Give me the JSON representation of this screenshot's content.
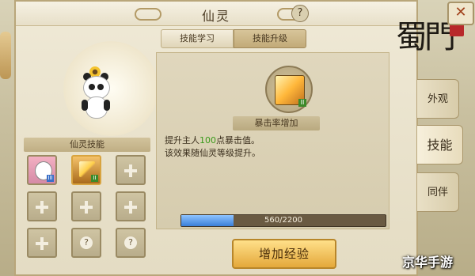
{
  "window": {
    "title": "仙灵"
  },
  "tabs": [
    {
      "label": "技能学习"
    },
    {
      "label": "技能升级"
    }
  ],
  "skills_panel": {
    "title": "仙灵技能"
  },
  "slots": [
    {
      "type": "pet",
      "badge": "III",
      "icon": "panda-avatar-icon"
    },
    {
      "type": "skill",
      "badge": "II",
      "icon": "crit-skill-icon"
    },
    {
      "type": "empty",
      "icon": "plus-icon"
    },
    {
      "type": "empty",
      "icon": "plus-icon"
    },
    {
      "type": "empty",
      "icon": "plus-icon"
    },
    {
      "type": "empty",
      "icon": "plus-icon"
    },
    {
      "type": "empty",
      "icon": "plus-icon"
    },
    {
      "type": "locked",
      "icon": "question-icon"
    },
    {
      "type": "locked",
      "icon": "question-icon"
    }
  ],
  "skill_detail": {
    "name": "暴击率增加",
    "badge": "II",
    "desc_prefix": "提升主人",
    "desc_value": "100",
    "desc_suffix": "点暴击值。",
    "desc_line2": "该效果随仙灵等级提升。"
  },
  "progress": {
    "current": 560,
    "max": 2200,
    "text": "560/2200"
  },
  "exp_button": {
    "label": "增加经验"
  },
  "side_nav": [
    {
      "label": "外观"
    },
    {
      "label": "技能"
    },
    {
      "label": "同伴"
    }
  ],
  "logo": {
    "text": "蜀門",
    "stamp": "手游"
  },
  "watermark": "京华手游",
  "colors": {
    "accent_gold": "#e4a83a",
    "progress_blue": "#3a7fd8",
    "highlight_green": "#3a9a1a"
  }
}
